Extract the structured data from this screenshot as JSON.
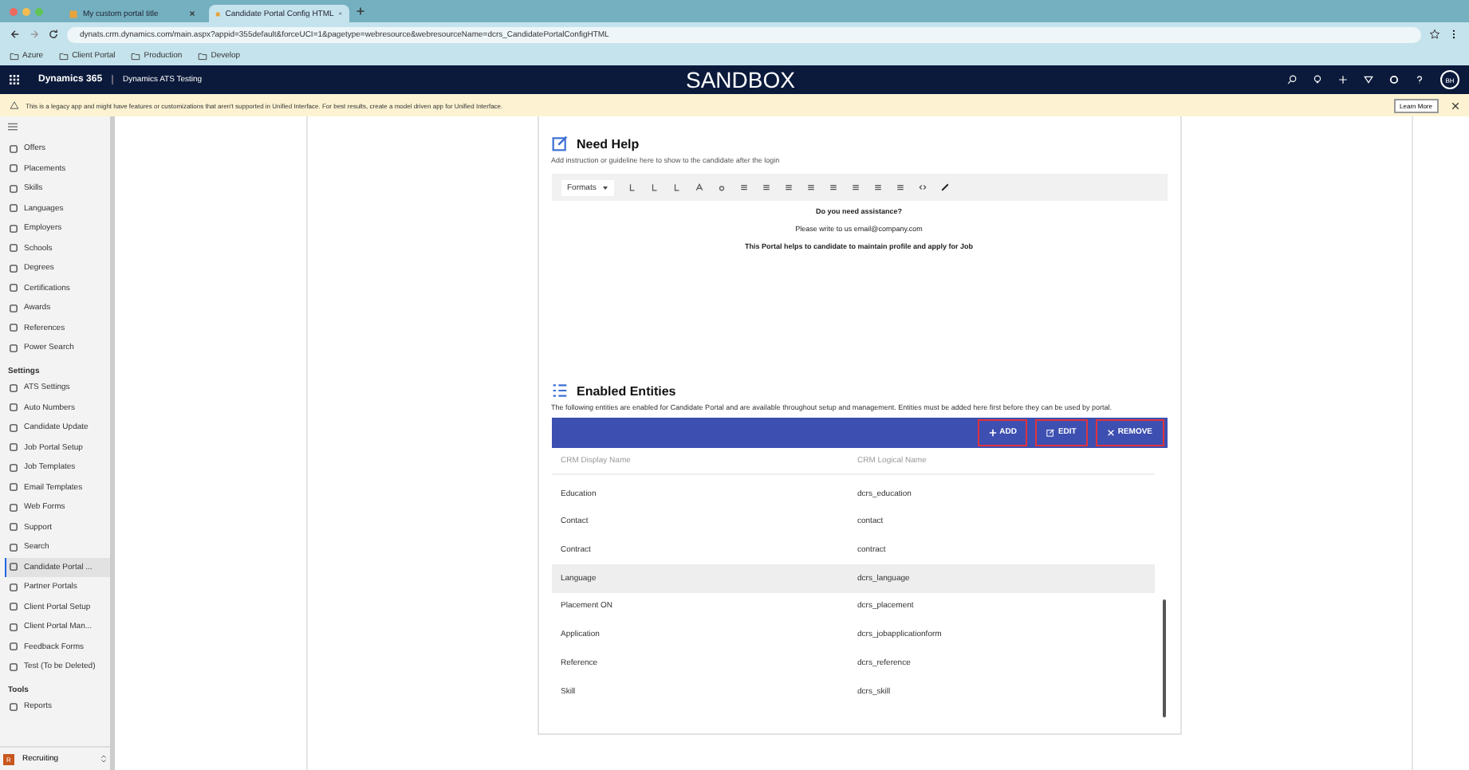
{
  "browser": {
    "tabs": [
      {
        "title": "My custom portal title",
        "selected": false
      },
      {
        "title": "Candidate Portal Config HTML",
        "selected": true
      }
    ],
    "address": "dynats.crm.dynamics.com/main.aspx?appid=355default&forceUCI=1&pagetype=webresource&webresourceName=dcrs_CandidatePortalConfigHTML",
    "bookmarks": [
      "Azure",
      "Client Portal",
      "Production",
      "Develop"
    ]
  },
  "header": {
    "app": "Dynamics 365",
    "area": "Dynamics ATS Testing",
    "environment": "SANDBOX",
    "user_initials": "BH"
  },
  "warning": {
    "text": "This is a legacy app and might have features or customizations that aren't supported in Unified Interface. For best results, create a model driven app for Unified Interface.",
    "button": "Learn More"
  },
  "sidebar": {
    "groups": [
      {
        "items": [
          {
            "label": "Offers",
            "selected": false
          },
          {
            "label": "Placements",
            "selected": false
          },
          {
            "label": "Skills",
            "selected": false
          },
          {
            "label": "Languages",
            "selected": false
          },
          {
            "label": "Employers",
            "selected": false
          },
          {
            "label": "Schools",
            "selected": false
          },
          {
            "label": "Degrees",
            "selected": false
          },
          {
            "label": "Certifications",
            "selected": false
          },
          {
            "label": "Awards",
            "selected": false
          },
          {
            "label": "References",
            "selected": false
          },
          {
            "label": "Power Search",
            "selected": false
          }
        ]
      },
      {
        "title": "Settings",
        "items": [
          {
            "label": "ATS Settings",
            "selected": false
          },
          {
            "label": "Auto Numbers",
            "selected": false
          },
          {
            "label": "Candidate Update",
            "selected": false
          },
          {
            "label": "Job Portal Setup",
            "selected": false
          },
          {
            "label": "Job Templates",
            "selected": false
          },
          {
            "label": "Email Templates",
            "selected": false
          },
          {
            "label": "Web Forms",
            "selected": false
          },
          {
            "label": "Support",
            "selected": false
          },
          {
            "label": "Search",
            "selected": false
          },
          {
            "label": "Candidate Portal ...",
            "selected": true
          },
          {
            "label": "Partner Portals",
            "selected": false
          },
          {
            "label": "Client Portal Setup",
            "selected": false
          },
          {
            "label": "Client Portal Man...",
            "selected": false
          },
          {
            "label": "Feedback Forms",
            "selected": false
          },
          {
            "label": "Test (To be Deleted)",
            "selected": false
          }
        ]
      },
      {
        "title": "Tools",
        "items": [
          {
            "label": "Reports",
            "selected": false
          }
        ]
      }
    ],
    "area_badge": "R",
    "area": "Recruiting"
  },
  "need_help": {
    "title": "Need Help",
    "hint": "Add instruction or guideline here to show to the candidate after the login",
    "format_label": "Formats",
    "content": [
      {
        "text": "Do you need assistance?",
        "bold": true
      },
      {
        "text": "Please write to us email@company.com",
        "bold": false
      },
      {
        "text": "This Portal helps to candidate to maintain profile and apply for Job",
        "bold": true
      }
    ]
  },
  "entities": {
    "title": "Enabled Entities",
    "description": "The following entities are enabled for Candidate Portal and are available throughout setup and management. Entities must be added here first before they can be used by portal.",
    "buttons": [
      "ADD",
      "EDIT",
      "REMOVE"
    ],
    "columns": [
      "CRM Display Name",
      "CRM Logical Name"
    ],
    "rows": [
      {
        "display": "Education",
        "logical": "dcrs_education",
        "selected": false
      },
      {
        "display": "Contact",
        "logical": "contact",
        "selected": false
      },
      {
        "display": "Contract",
        "logical": "contract",
        "selected": false
      },
      {
        "display": "Language",
        "logical": "dcrs_language",
        "selected": true
      },
      {
        "display": "Placement ON",
        "logical": "dcrs_placement",
        "selected": false
      },
      {
        "display": "Application",
        "logical": "dcrs_jobapplicationform",
        "selected": false
      },
      {
        "display": "Reference",
        "logical": "dcrs_reference",
        "selected": false
      },
      {
        "display": "Skill",
        "logical": "dcrs_skill",
        "selected": false
      }
    ]
  }
}
